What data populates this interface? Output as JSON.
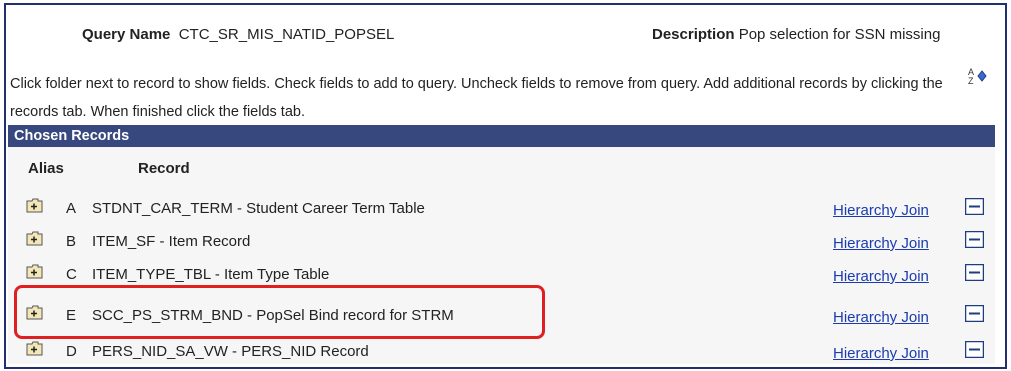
{
  "header": {
    "query_name_label": "Query Name",
    "query_name_value": "CTC_SR_MIS_NATID_POPSEL",
    "description_label": "Description",
    "description_value": "Pop selection for SSN missing"
  },
  "instructions": "Click folder next to record to show fields. Check fields to add to query. Uncheck fields to remove from query. Add additional records by clicking the records tab. When finished click the fields tab.",
  "section_title": "Chosen Records",
  "columns": {
    "alias": "Alias",
    "record": "Record"
  },
  "records": [
    {
      "alias": "A",
      "record": "STDNT_CAR_TERM - Student Career Term Table",
      "join": "Hierarchy Join"
    },
    {
      "alias": "B",
      "record": "ITEM_SF - Item Record",
      "join": "Hierarchy Join"
    },
    {
      "alias": "C",
      "record": "ITEM_TYPE_TBL - Item Type Table",
      "join": "Hierarchy Join"
    },
    {
      "alias": "E",
      "record": "SCC_PS_STRM_BND - PopSel Bind record for STRM",
      "join": "Hierarchy Join"
    },
    {
      "alias": "D",
      "record": "PERS_NID_SA_VW - PERS_NID Record",
      "join": "Hierarchy Join"
    }
  ],
  "highlight_color": "#e02020",
  "section_color": "#37487e"
}
